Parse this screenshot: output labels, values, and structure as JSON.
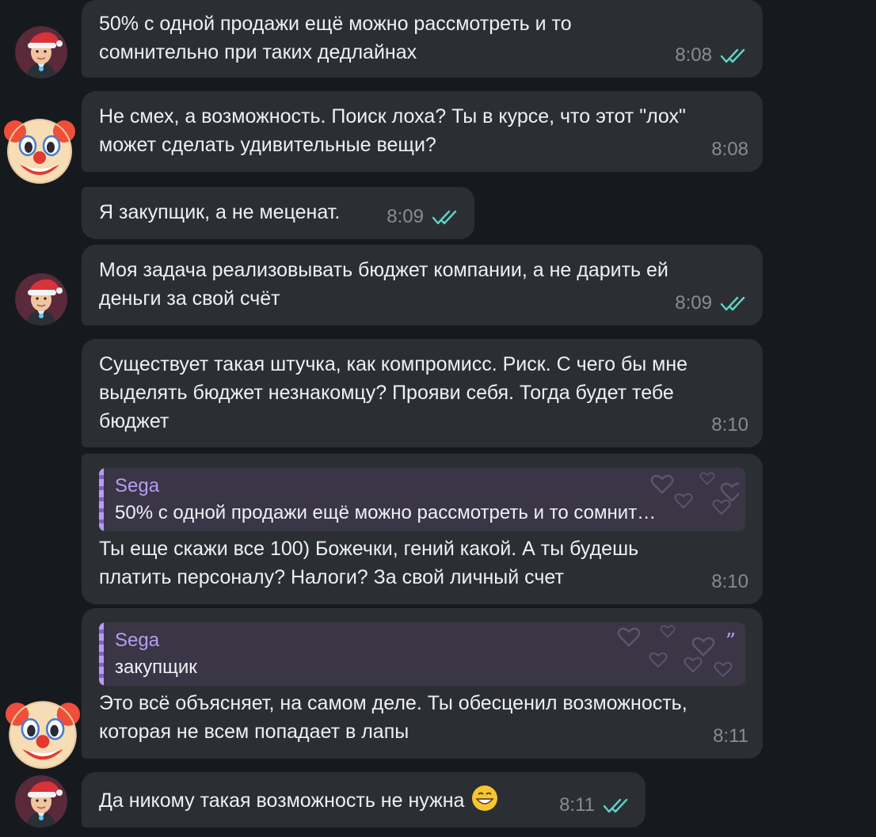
{
  "messages": [
    {
      "text": "50% с одной продажи ещё можно рассмотреть и то\nсомнительно при таких дедлайнах",
      "time": "8:08",
      "read": true
    },
    {
      "text": "Не смех, а возможность. Поиск лоха? Ты в курсе, что этот \"лох\"\nможет сделать удивительные вещи?",
      "time": "8:08"
    },
    {
      "text": "Я закупщик, а не меценат.",
      "time": "8:09",
      "read": true
    },
    {
      "text": "Моя задача реализовывать бюджет компании, а не дарить ей\nденьги за свой счёт",
      "time": "8:09",
      "read": true
    },
    {
      "text": "Существует такая штучка, как компромисс. Риск. С чего бы мне\nвыделять бюджет незнакомцу? Прояви себя. Тогда будет тебе\nбюджет",
      "time": "8:10"
    },
    {
      "reply": {
        "author": "Sega",
        "text": "50% с одной продажи ещё можно рассмотреть и то сомнит…"
      },
      "text": "Ты еще скажи все 100) Божечки, гений какой. А ты будешь\nплатить персоналу? Налоги? За свой личный счет",
      "time": "8:10"
    },
    {
      "reply": {
        "author": "Sega",
        "text": "закупщик"
      },
      "text": "Это всё объясняет, на самом деле. Ты обесценил возможность,\nкоторая не всем попадает в лапы",
      "time": "8:11"
    },
    {
      "text": "Да никому такая возможность не нужна",
      "time": "8:11",
      "read": true,
      "emoji": "grin-emoji"
    }
  ],
  "colors": {
    "background": "#161a1f",
    "bubble": "#2b2f33",
    "reply_accent": "#b79df3",
    "check": "#5fd3c8",
    "time": "#878c92"
  }
}
